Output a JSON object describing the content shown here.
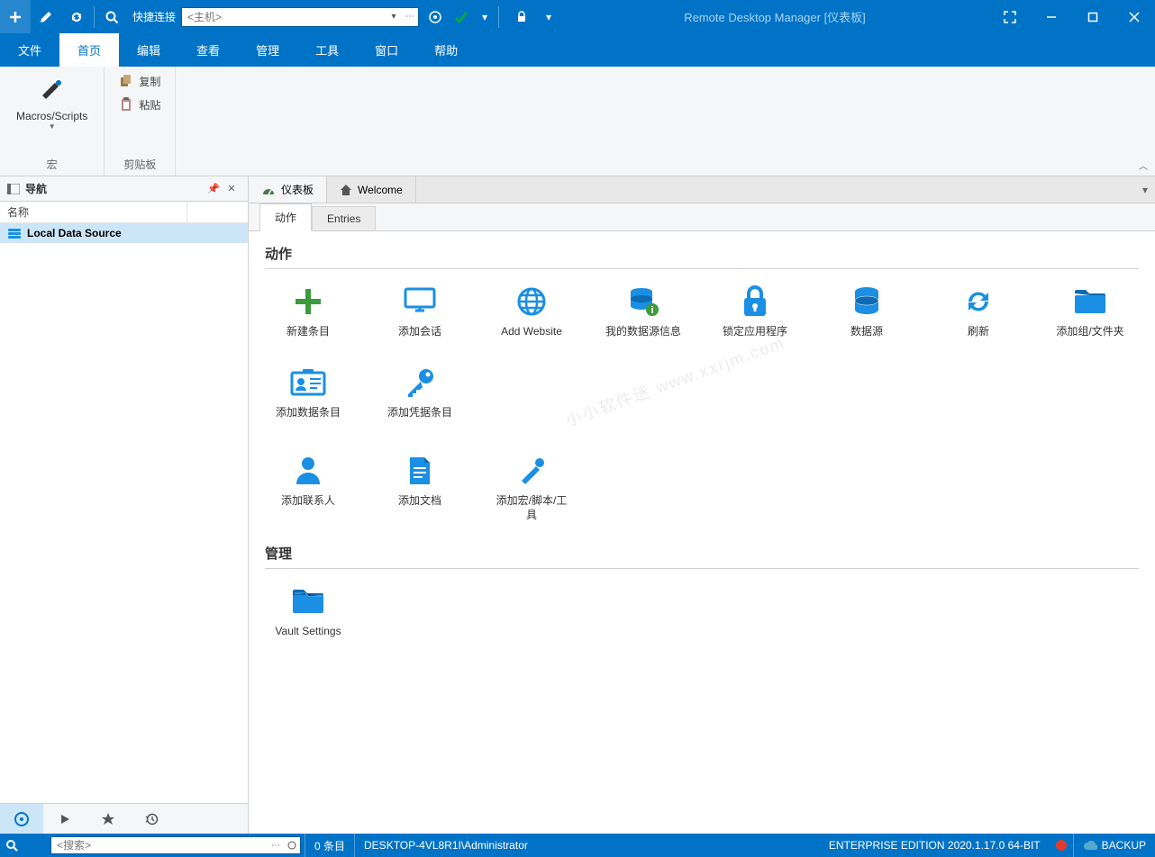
{
  "app": {
    "title": "Remote Desktop Manager [仪表板]",
    "quick_connect_label": "快捷连接",
    "host_placeholder": "<主机>"
  },
  "menu": {
    "file": "文件",
    "home": "首页",
    "edit": "编辑",
    "view": "查看",
    "admin": "管理",
    "tools": "工具",
    "window": "窗口",
    "help": "帮助"
  },
  "ribbon": {
    "macros": "Macros/Scripts",
    "group_macro": "宏",
    "copy": "复制",
    "paste": "粘贴",
    "group_clipboard": "剪贴板"
  },
  "nav": {
    "title": "导航",
    "col_name": "名称",
    "tree_root": "Local Data Source"
  },
  "tabs": {
    "dashboard": "仪表板",
    "welcome": "Welcome"
  },
  "subtabs": {
    "actions": "动作",
    "entries": "Entries"
  },
  "dashboard": {
    "section_actions": "动作",
    "section_admin": "管理",
    "items": {
      "new_entry": "新建条目",
      "add_session": "添加会话",
      "add_website": "Add Website",
      "my_ds_info": "我的数据源信息",
      "lock_app": "锁定应用程序",
      "data_sources": "数据源",
      "refresh": "刷新",
      "add_folder": "添加组/文件夹",
      "add_data_entry": "添加数据条目",
      "add_cred_entry": "添加凭据条目",
      "add_contact": "添加联系人",
      "add_document": "添加文档",
      "add_macro": "添加宏/脚本/工具",
      "vault_settings": "Vault Settings"
    }
  },
  "status": {
    "search_placeholder": "<搜索>",
    "entries": "0 条目",
    "machine": "DESKTOP-4VL8R1I\\Administrator",
    "edition": "ENTERPRISE EDITION 2020.1.17.0 64-BIT",
    "backup": "BACKUP"
  },
  "colors": {
    "primary": "#0173c7",
    "icon_blue": "#1a8fe3",
    "green": "#3a9c3a",
    "red": "#e23b2e"
  }
}
